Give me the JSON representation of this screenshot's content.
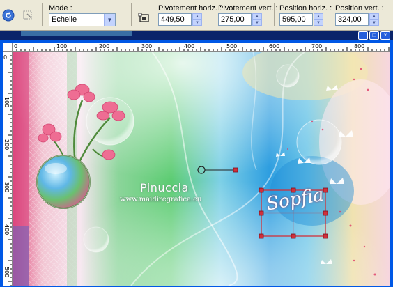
{
  "toolbar": {
    "mode_label": "Mode :",
    "mode_value": "Echelle",
    "pivot_h_label": "Pivotement horiz. :",
    "pivot_h_value": "449,50",
    "pivot_v_label": "Pivotement vert. :",
    "pivot_v_value": "275,00",
    "pos_h_label": "Position horiz. :",
    "pos_h_value": "595,00",
    "pos_v_label": "Position vert. :",
    "pos_v_value": "324,00"
  },
  "ruler": {
    "h_ticks": [
      "0",
      "100",
      "200",
      "300",
      "400",
      "500",
      "600",
      "700",
      "800"
    ],
    "v_ticks": [
      "0",
      "100",
      "200",
      "300",
      "400",
      "500"
    ]
  },
  "artwork": {
    "watermark_name": "Pinuccia",
    "watermark_url": "www.maidiregrafica.eu",
    "signature": "Sopfia"
  },
  "colors": {
    "selection_handle": "#d0303a",
    "toolbar_bg": "#ece9d8",
    "frame_blue": "#0058e6"
  }
}
